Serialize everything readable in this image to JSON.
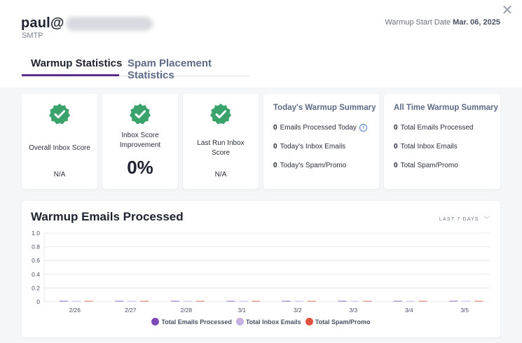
{
  "header": {
    "email_prefix": "paul@",
    "email_subtitle": "SMTP",
    "start_date_label": "Warmup Start Date",
    "start_date_value": "Mar. 06, 2025",
    "close_glyph": "✕"
  },
  "tabs": [
    {
      "label": "Warmup Statistics",
      "active": true
    },
    {
      "label": "Spam Placement Statistics",
      "active": false
    }
  ],
  "score_cards": [
    {
      "title": "Overall Inbox Score",
      "value": "N/A"
    },
    {
      "title": "Inbox Score Improvement",
      "value": "0%"
    },
    {
      "title": "Last Run Inbox Score",
      "value": "N/A"
    }
  ],
  "today_summary": {
    "title": "Today's Warmup Summary",
    "rows": [
      {
        "count": "0",
        "label": "Emails Processed Today"
      },
      {
        "count": "0",
        "label": "Today's Inbox Emails"
      },
      {
        "count": "0",
        "label": "Today's Spam/Promo"
      }
    ]
  },
  "alltime_summary": {
    "title": "All Time Warmup Summary",
    "rows": [
      {
        "count": "0",
        "label": "Total Emails Processed"
      },
      {
        "count": "0",
        "label": "Total Inbox Emails"
      },
      {
        "count": "0",
        "label": "Total Spam/Promo"
      }
    ]
  },
  "chart_section": {
    "title": "Warmup Emails Processed",
    "range_label": "LAST 7 DAYS"
  },
  "colors": {
    "check_green": "#3aa36b",
    "tab_accent": "#5a2f86",
    "series_processed": "#7e4ab8",
    "series_inbox": "#c6b0e3",
    "series_spam": "#e0533f"
  },
  "chart_data": {
    "type": "bar",
    "categories": [
      "2/26",
      "2/27",
      "2/28",
      "3/1",
      "3/2",
      "3/3",
      "3/4",
      "3/5"
    ],
    "series": [
      {
        "name": "Total Emails Processed",
        "values": [
          0,
          0,
          0,
          0,
          0,
          0,
          0,
          0
        ]
      },
      {
        "name": "Total Inbox Emails",
        "values": [
          0,
          0,
          0,
          0,
          0,
          0,
          0,
          0
        ]
      },
      {
        "name": "Total Spam/Promo",
        "values": [
          0,
          0,
          0,
          0,
          0,
          0,
          0,
          0
        ]
      }
    ],
    "yticks": [
      "0",
      "0.2",
      "0.4",
      "0.6",
      "0.8",
      "1.0"
    ],
    "ylim": [
      0,
      1
    ],
    "grid": true,
    "legend": "bottom"
  }
}
